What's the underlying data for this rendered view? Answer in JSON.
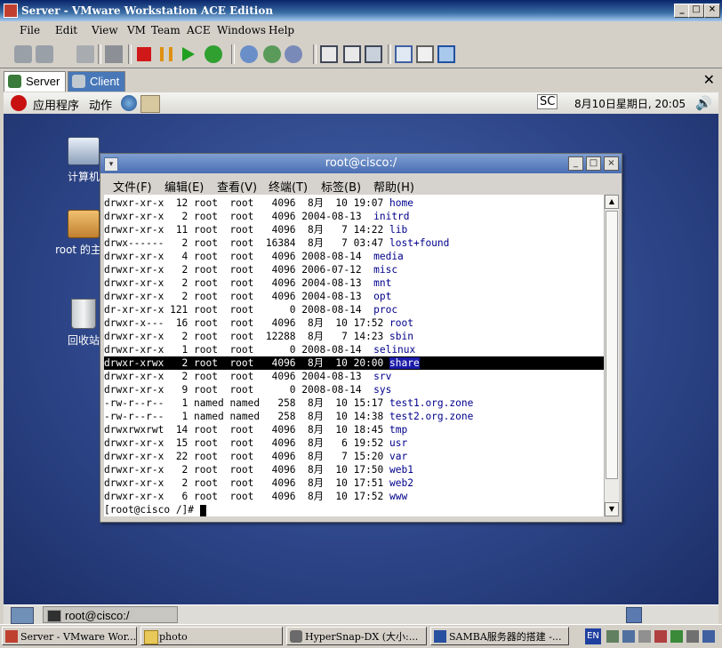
{
  "window": {
    "title": "Server - VMware Workstation ACE Edition"
  },
  "menus": [
    "File",
    "Edit",
    "View",
    "VM",
    "Team",
    "ACE",
    "Windows",
    "Help"
  ],
  "tabs": [
    {
      "label": "Server"
    },
    {
      "label": "Client"
    }
  ],
  "guest_panel": {
    "apps": "应用程序",
    "actions": "动作",
    "sc": "SC",
    "clock": "8月10日星期日, 20:05"
  },
  "desktop_icons": [
    {
      "label": "计算机"
    },
    {
      "label": "root 的主目"
    },
    {
      "label": "回收站"
    }
  ],
  "terminal": {
    "title": "root@cisco:/",
    "menus": [
      "文件(F)",
      "编辑(E)",
      "查看(V)",
      "终端(T)",
      "标签(B)",
      "帮助(H)"
    ],
    "prompt": "[root@cisco /]# ",
    "rows": [
      {
        "line": "drwxr-xr-x  12 root  root   4096  8月  10 19:07 ",
        "name": "home"
      },
      {
        "line": "drwxr-xr-x   2 root  root   4096 2004-08-13  ",
        "name": "initrd"
      },
      {
        "line": "drwxr-xr-x  11 root  root   4096  8月   7 14:22 ",
        "name": "lib"
      },
      {
        "line": "drwx------   2 root  root  16384  8月   7 03:47 ",
        "name": "lost+found"
      },
      {
        "line": "drwxr-xr-x   4 root  root   4096 2008-08-14  ",
        "name": "media"
      },
      {
        "line": "drwxr-xr-x   2 root  root   4096 2006-07-12  ",
        "name": "misc"
      },
      {
        "line": "drwxr-xr-x   2 root  root   4096 2004-08-13  ",
        "name": "mnt"
      },
      {
        "line": "drwxr-xr-x   2 root  root   4096 2004-08-13  ",
        "name": "opt"
      },
      {
        "line": "dr-xr-xr-x 121 root  root      0 2008-08-14  ",
        "name": "proc"
      },
      {
        "line": "drwxr-x---  16 root  root   4096  8月  10 17:52 ",
        "name": "root"
      },
      {
        "line": "drwxr-xr-x   2 root  root  12288  8月   7 14:23 ",
        "name": "sbin"
      },
      {
        "line": "drwxr-xr-x   1 root  root      0 2008-08-14  ",
        "name": "selinux"
      },
      {
        "line": "drwxr-xrwx   2 root  root   4096  8月  10 20:00 ",
        "name": "share",
        "selected": true
      },
      {
        "line": "drwxr-xr-x   2 root  root   4096 2004-08-13  ",
        "name": "srv"
      },
      {
        "line": "drwxr-xr-x   9 root  root      0 2008-08-14  ",
        "name": "sys"
      },
      {
        "line": "-rw-r--r--   1 named named   258  8月  10 15:17 ",
        "name": "test1.org.zone"
      },
      {
        "line": "-rw-r--r--   1 named named   258  8月  10 14:38 ",
        "name": "test2.org.zone"
      },
      {
        "line": "drwxrwxrwt  14 root  root   4096  8月  10 18:45 ",
        "name": "tmp"
      },
      {
        "line": "drwxr-xr-x  15 root  root   4096  8月   6 19:52 ",
        "name": "usr"
      },
      {
        "line": "drwxr-xr-x  22 root  root   4096  8月   7 15:20 ",
        "name": "var"
      },
      {
        "line": "drwxr-xr-x   2 root  root   4096  8月  10 17:50 ",
        "name": "web1"
      },
      {
        "line": "drwxr-xr-x   2 root  root   4096  8月  10 17:51 ",
        "name": "web2"
      },
      {
        "line": "drwxr-xr-x   6 root  root   4096  8月  10 17:52 ",
        "name": "www"
      }
    ]
  },
  "guest_taskbar": {
    "label": "root@cisco:/"
  },
  "host_taskbar": [
    {
      "label": "Server - VMware Wor..."
    },
    {
      "label": "photo"
    },
    {
      "label": "HyperSnap-DX (大小:..."
    },
    {
      "label": "SAMBA服务器的搭建 -..."
    }
  ],
  "tray": {
    "lang": "EN"
  },
  "colors": {
    "desktop": "#2c4486",
    "selected_row": "#000000",
    "dir_name": "#00008b"
  }
}
